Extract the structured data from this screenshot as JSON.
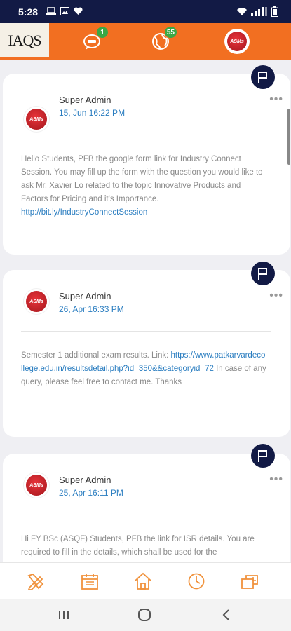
{
  "status_bar": {
    "time": "5:28",
    "left_icons": [
      "laptop-icon",
      "image-icon",
      "heart-icon"
    ],
    "right_icons": [
      "wifi-icon",
      "signal-icon",
      "battery-icon"
    ]
  },
  "app_bar": {
    "logo_text": "IAQS",
    "chat_badge": "1",
    "globe_badge": "55",
    "avatar_text": "ASMs"
  },
  "posts": [
    {
      "author": "Super Admin",
      "timestamp": "15, Jun 16:22 PM",
      "text": "Hello Students, PFB the google form link for Industry Connect Session. You may fill up the form with the question you would like to ask Mr. Xavier Lo related to the topic Innovative Products and Factors for Pricing and it's Importance. ",
      "link": "http://bit.ly/IndustryConnectSession",
      "text_after": ""
    },
    {
      "author": "Super Admin",
      "timestamp": "26, Apr 16:33 PM",
      "text": "Semester 1 additional exam results. Link: ",
      "link": "https://www.patkarvardecollege.edu.in/resultsdetail.php?id=350&&categoryid=72",
      "text_after": " In case of any query, please feel free to contact me. Thanks"
    },
    {
      "author": "Super Admin",
      "timestamp": "25, Apr 16:11 PM",
      "text": "Hi FY BSc (ASQF) Students, PFB the link for ISR details. You are required to fill in the details, which shall be used for the",
      "link": "",
      "text_after": ""
    }
  ],
  "more_label": "•••",
  "bottom_nav": [
    "pencil-ruler-icon",
    "calendar-icon",
    "home-icon",
    "clock-icon",
    "mailbox-icon"
  ],
  "system_nav": [
    "recents-icon",
    "home-circle-icon",
    "back-icon"
  ],
  "colors": {
    "brand_orange": "#f26f21",
    "navy": "#121a45",
    "link_blue": "#2a7dc0",
    "badge_green": "#3aa845"
  }
}
